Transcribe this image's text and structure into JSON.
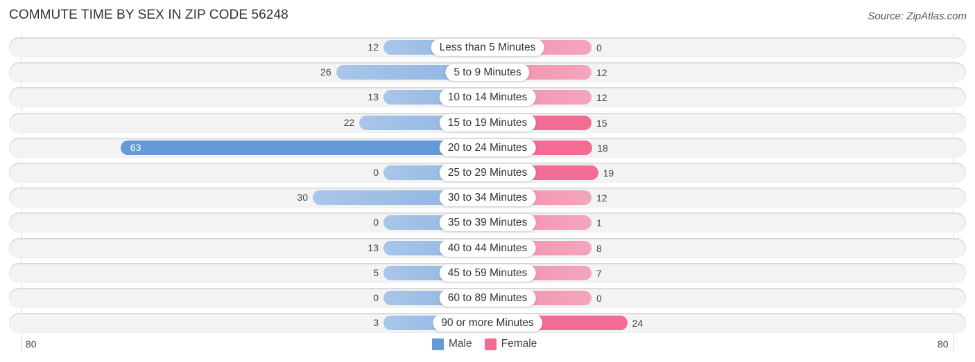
{
  "header": {
    "title": "COMMUTE TIME BY SEX IN ZIP CODE 56248",
    "source": "Source: ZipAtlas.com"
  },
  "chart_data": {
    "type": "bar",
    "orientation": "horizontal-diverging",
    "title": "COMMUTE TIME BY SEX IN ZIP CODE 56248",
    "categories": [
      "Less than 5 Minutes",
      "5 to 9 Minutes",
      "10 to 14 Minutes",
      "15 to 19 Minutes",
      "20 to 24 Minutes",
      "25 to 29 Minutes",
      "30 to 34 Minutes",
      "35 to 39 Minutes",
      "40 to 44 Minutes",
      "45 to 59 Minutes",
      "60 to 89 Minutes",
      "90 or more Minutes"
    ],
    "series": [
      {
        "name": "Male",
        "color": "#6699d8",
        "values": [
          12,
          26,
          13,
          22,
          63,
          0,
          30,
          0,
          13,
          5,
          0,
          3
        ]
      },
      {
        "name": "Female",
        "color": "#f26c94",
        "values": [
          0,
          12,
          12,
          15,
          18,
          19,
          12,
          1,
          8,
          7,
          0,
          24
        ]
      }
    ],
    "xlim": [
      -80,
      80
    ],
    "tick_labels": {
      "left": "80",
      "right": "80"
    },
    "legend": {
      "position": "bottom-center",
      "entries": [
        "Male",
        "Female"
      ]
    }
  }
}
